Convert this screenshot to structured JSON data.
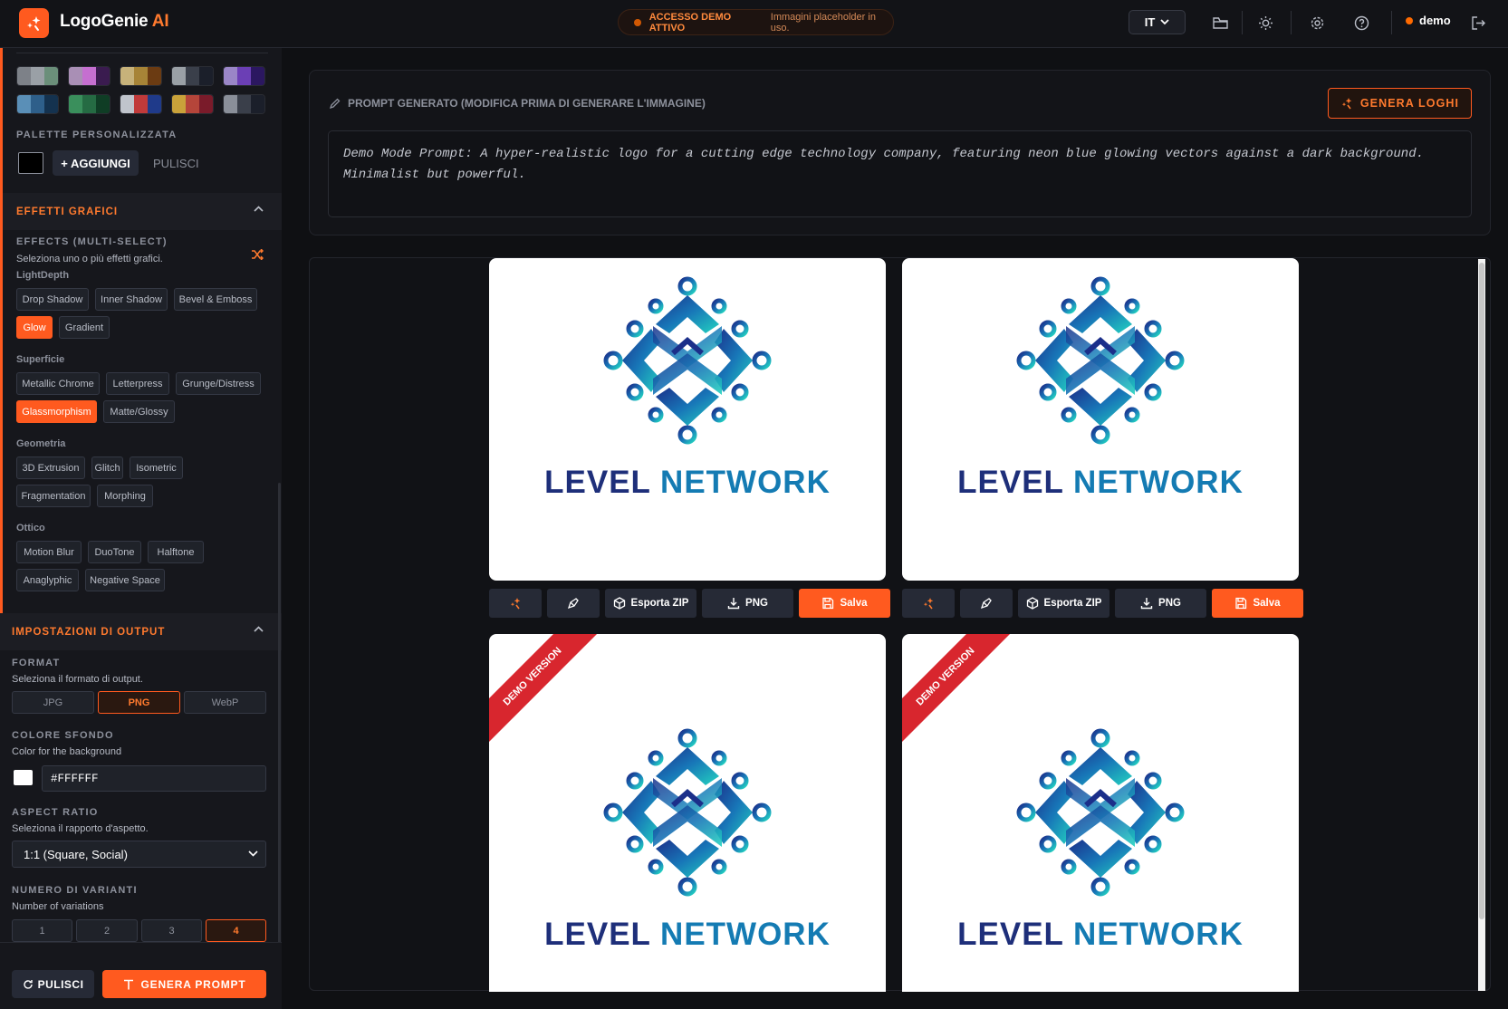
{
  "header": {
    "app_name": "LogoGenie",
    "app_name_suffix": "AI",
    "demo_status": "ACCESSO DEMO ATTIVO",
    "demo_note": "Immagini placeholder in uso.",
    "language": "IT",
    "user": "demo",
    "icons": [
      "folder-icon",
      "sun-icon",
      "gear-icon",
      "help-icon",
      "logout-icon"
    ]
  },
  "sidebar": {
    "swatch_rows": [
      [
        [
          "#7d8188",
          "#9aa0a6",
          "#6b8f7a"
        ],
        [
          "#a98fb5",
          "#c56fd0",
          "#3a1b4f"
        ],
        [
          "#c7b27a",
          "#a78437",
          "#6b3b12"
        ],
        [
          "#9aa0a6",
          "#3a3f4a",
          "#1b1f2a"
        ],
        [
          "#9a86c7",
          "#6b3fb5",
          "#2b1760"
        ]
      ],
      [
        [
          "#5a8fb7",
          "#2e5f8a",
          "#14324f"
        ],
        [
          "#3a8f5c",
          "#256b43",
          "#0f3d25"
        ],
        [
          "#c0c4cc",
          "#c13a3a",
          "#1f3a8a"
        ],
        [
          "#c9a23a",
          "#b5453a",
          "#7a1b2a"
        ],
        [
          "#8a8f99",
          "#3a3f4a",
          "#1b1f2a"
        ]
      ]
    ],
    "custom_palette_label": "PALETTE PERSONALIZZATA",
    "custom_color": "#000000",
    "add_label": "+ AGGIUNGI",
    "clear_label": "PULISCI",
    "effects_section": "EFFETTI GRAFICI",
    "effects_title": "EFFECTS (MULTI-SELECT)",
    "effects_desc": "Seleziona uno o più effetti grafici.",
    "groups": [
      {
        "name": "LightDepth",
        "rows": [
          [
            "Drop Shadow",
            "Inner Shadow",
            "Bevel & Emboss"
          ],
          [
            "Glow",
            "Gradient"
          ]
        ]
      },
      {
        "name": "Superficie",
        "rows": [
          [
            "Metallic Chrome",
            "Letterpress",
            "Grunge/Distress"
          ],
          [
            "Glassmorphism",
            "Matte/Glossy"
          ]
        ]
      },
      {
        "name": "Geometria",
        "rows": [
          [
            "3D Extrusion",
            "Glitch",
            "Isometric"
          ],
          [
            "Fragmentation",
            "Morphing"
          ]
        ]
      },
      {
        "name": "Ottico",
        "rows": [
          [
            "Motion Blur",
            "DuoTone",
            "Halftone"
          ],
          [
            "Anaglyphic",
            "Negative Space"
          ]
        ]
      }
    ],
    "selected_effects": [
      "Glow",
      "Glassmorphism"
    ],
    "output_section": "IMPOSTAZIONI DI OUTPUT",
    "format_title": "FORMAT",
    "format_desc": "Seleziona il formato di output.",
    "formats": [
      "JPG",
      "PNG",
      "WebP"
    ],
    "selected_format": "PNG",
    "bg_title": "COLORE SFONDO",
    "bg_desc": "Color for the background",
    "bg_color": "#FFFFFF",
    "aspect_title": "ASPECT RATIO",
    "aspect_desc": "Seleziona il rapporto d'aspetto.",
    "aspect_value": "1:1 (Square, Social)",
    "variants_title": "NUMERO DI VARIANTI",
    "variants_desc": "Number of variations",
    "variants": [
      "1",
      "2",
      "3",
      "4"
    ],
    "selected_variant": "4",
    "footer_clear": "PULISCI",
    "footer_generate": "GENERA PROMPT"
  },
  "prompt": {
    "title": "PROMPT GENERATO (MODIFICA PRIMA DI GENERARE L'IMMAGINE)",
    "generate_label": "GENERA LOGHI",
    "text": "Demo Mode Prompt: A hyper-realistic logo for a cutting edge technology company, featuring neon blue glowing vectors against a dark background. Minimalist but powerful."
  },
  "gallery": {
    "brand_word1": "LEVEL",
    "brand_word2": "NETWORK",
    "ribbon": "DEMO VERSION",
    "actions": {
      "export_zip": "Esporta ZIP",
      "png": "PNG",
      "save": "Salva"
    }
  }
}
